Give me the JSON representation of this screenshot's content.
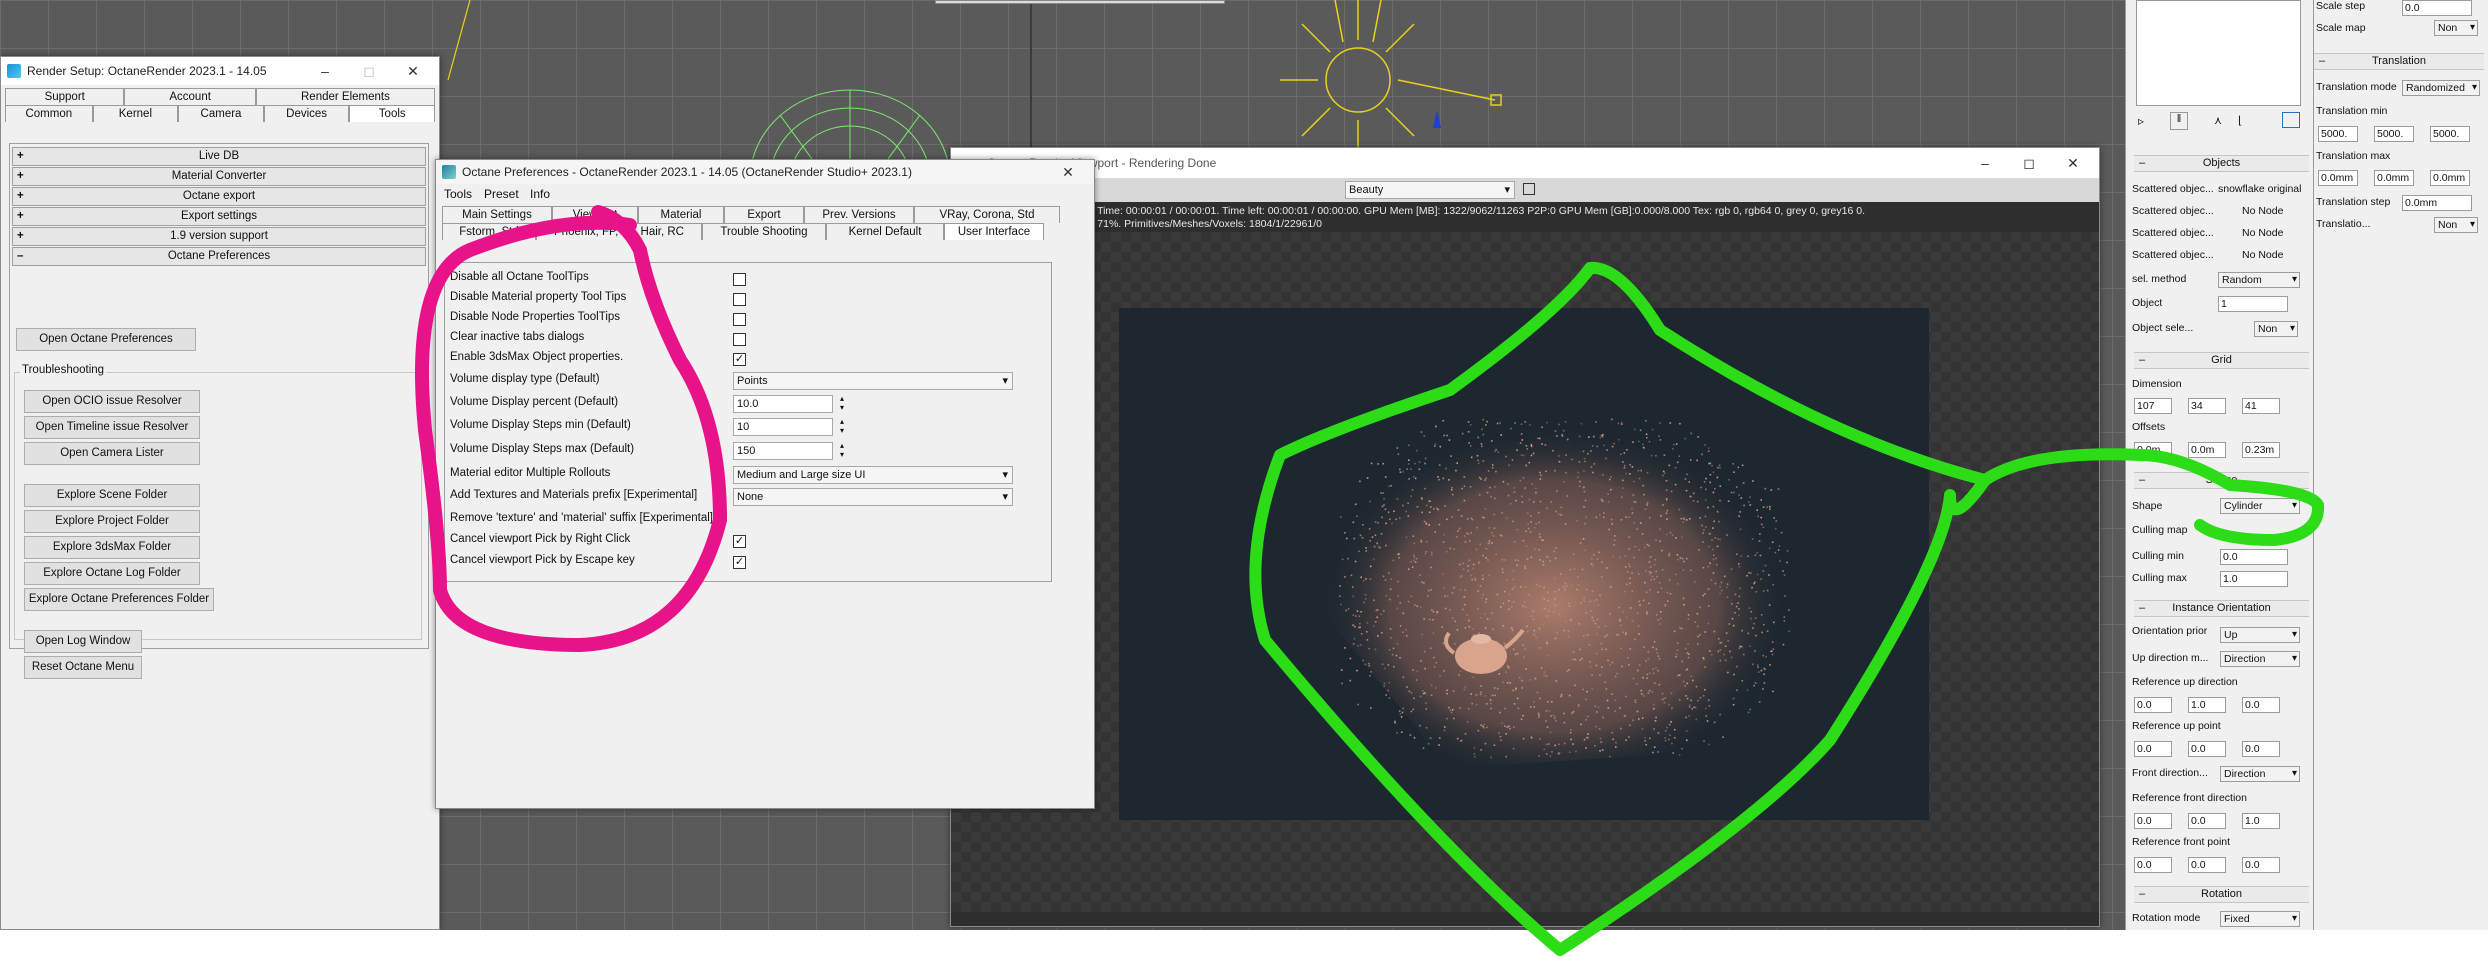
{
  "colors": {
    "pink_annotation": "#e8138a",
    "green_annotation": "#2bdc17",
    "render_bg": "#1d2730",
    "particles": "#c48a76"
  },
  "render_setup": {
    "title": "Render Setup: OctaneRender 2023.1 - 14.05",
    "tabs_row1": [
      "Support",
      "Account",
      "Render Elements"
    ],
    "tabs_row2": [
      "Common",
      "Kernel",
      "Camera",
      "Devices",
      "Tools"
    ],
    "rollouts": [
      "Live DB",
      "Material Converter",
      "Octane export",
      "Export settings",
      "1.9 version support",
      "Octane Preferences"
    ],
    "open_prefs_button": "Open Octane Preferences",
    "troubleshooting_label": "Troubleshooting",
    "trouble_buttons": [
      "Open OCIO issue Resolver",
      "Open Timeline issue Resolver",
      "Open Camera Lister"
    ],
    "folder_buttons": [
      "Explore Scene Folder",
      "Explore Project Folder",
      "Explore 3dsMax Folder",
      "Explore Octane Log Folder",
      "Explore Octane Preferences Folder"
    ],
    "log_buttons": [
      "Open Log Window",
      "Reset Octane Menu"
    ]
  },
  "prefs": {
    "title": "Octane Preferences - OctaneRender 2023.1 - 14.05 (OctaneRender Studio+ 2023.1)",
    "menu": [
      "Tools",
      "Preset",
      "Info"
    ],
    "tabs_row1": [
      "Main Settings",
      "Viewport",
      "Material",
      "Export",
      "Prev. Versions",
      "VRay, Corona, Std"
    ],
    "tabs_row2": [
      "Fstorm, Std",
      "Phoenix, FP, TF, Hair, RC",
      "Trouble Shooting",
      "Kernel Default",
      "User Interface"
    ],
    "rows": [
      "Disable all Octane ToolTips",
      "Disable Material property Tool Tips",
      "Disable Node Properties ToolTips",
      "Clear inactive tabs dialogs",
      "Enable 3dsMax Object properties.",
      "Volume display type (Default)",
      "Volume Display percent (Default)",
      "Volume Display Steps min (Default)",
      "Volume Display Steps max (Default)",
      "Material editor Multiple Rollouts",
      "Add Textures and Materials prefix [Experimental]",
      "Remove 'texture' and 'material' suffix [Experimental]",
      "Cancel viewport Pick by Right Click",
      "Cancel viewport Pick by Escape key"
    ],
    "checkbox_states": [
      false,
      false,
      false,
      false,
      true
    ],
    "checkbox_states_bottom": [
      true,
      true
    ],
    "volume_display_type": "Points",
    "volume_display_percent": "10.0",
    "volume_steps_min": "10",
    "volume_steps_max": "150",
    "material_rollouts": "Medium and Large size UI",
    "prefix_option": "None"
  },
  "viewport": {
    "title": "Octane Render Viewport - Rendering Done",
    "pass_selector": "Beauty",
    "stats_line1": "00M.  Time: 00:00:01 / 00:00:01.  Time left: 00:00:01 / 00:00:00.  GPU Mem [MB]: 1322/9062/11263 P2P:0   GPU Mem [GB]:0.000/8.000   Tex: rgb 0, rgb64 0, grey 0, grey16 0.",
    "stats_line2": "oom: 71%.  Primitives/Meshes/Voxels: 1804/1/22961/0"
  },
  "side_panel": {
    "objects_header": "Objects",
    "scattered_rows": [
      {
        "label": "Scattered objec...",
        "value": "snowflake original"
      },
      {
        "label": "Scattered objec...",
        "value": "No Node"
      },
      {
        "label": "Scattered objec...",
        "value": "No Node"
      },
      {
        "label": "Scattered objec...",
        "value": "No Node"
      }
    ],
    "sel_method_label": "sel. method",
    "sel_method": "Random",
    "object_label": "Object",
    "object_value": "1",
    "object_sele_label": "Object sele...",
    "object_sele_value": "Non",
    "grid_header": "Grid",
    "dimension_label": "Dimension",
    "dimension": [
      "107",
      "34",
      "41"
    ],
    "offsets_label": "Offsets",
    "offsets": [
      "0.0m",
      "0.0m",
      "0.23m"
    ],
    "shape_header": "Shape",
    "shape_label": "Shape",
    "shape_value": "Cylinder",
    "culling_map_label": "Culling map",
    "culling_min_label": "Culling min",
    "culling_min": "0.0",
    "culling_max_label": "Culling max",
    "culling_max": "1.0",
    "instance_header": "Instance Orientation",
    "orientation_label": "Orientation prior",
    "orientation_value": "Up",
    "up_dir_label": "Up direction m...",
    "up_dir_value": "Direction",
    "ref_up_dir_label": "Reference up direction",
    "ref_up_dir": [
      "0.0",
      "1.0",
      "0.0"
    ],
    "ref_up_point_label": "Reference up point",
    "ref_up_point": [
      "0.0",
      "0.0",
      "0.0"
    ],
    "front_dir_label": "Front direction...",
    "front_dir_value": "Direction",
    "ref_front_dir_label": "Reference front direction",
    "ref_front_dir": [
      "0.0",
      "0.0",
      "1.0"
    ],
    "ref_front_point_label": "Reference front point",
    "ref_front_point": [
      "0.0",
      "0.0",
      "0.0"
    ],
    "rotation_header": "Rotation",
    "rotation_mode_label": "Rotation mode",
    "rotation_mode_value": "Fixed"
  },
  "far_panel": {
    "scale_step_label": "Scale step",
    "scale_step": "0.0",
    "scale_map_label": "Scale map",
    "scale_map": "Non",
    "translation_header": "Translation",
    "translation_mode_label": "Translation mode",
    "translation_mode": "Randomized",
    "translation_min_label": "Translation min",
    "translation_min": [
      "5000.",
      "5000.",
      "5000."
    ],
    "translation_max_label": "Translation max",
    "translation_max": [
      "0.0mm",
      "0.0mm",
      "0.0mm"
    ],
    "translation_step_label": "Translation step",
    "translation_step": "0.0mm",
    "translatio_label": "Translatio...",
    "translatio_value": "Non"
  }
}
